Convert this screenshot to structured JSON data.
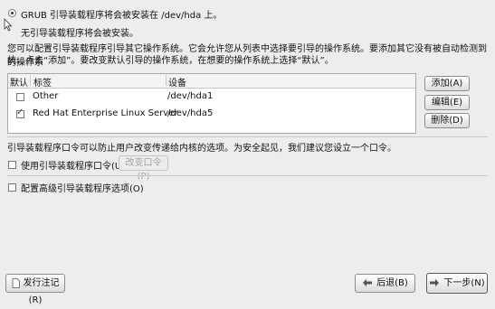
{
  "boot_target": {
    "grub_option": "GRUB 引导装载程序将会被安装在 /dev/hda 上。",
    "none_option": "无引导装载程序将会被安装。"
  },
  "description": {
    "line1": "您可以配置引导装载程序引导其它操作系统。它会允许您从列表中选择要引导的操作系统。要添加其它没有被自动检测到的操作系",
    "line2": "统，点击“添加”。要改变默认引导的操作系统，在想要的操作系统上选择“默认”。"
  },
  "table": {
    "headers": {
      "default": "默认",
      "label": "标签",
      "device": "设备"
    },
    "rows": [
      {
        "checked": false,
        "label": "Other",
        "device": "/dev/hda1"
      },
      {
        "checked": true,
        "label": "Red Hat Enterprise Linux Server",
        "device": "/dev/hda5"
      }
    ]
  },
  "side_buttons": {
    "add": "添加(A)",
    "edit": "编辑(E)",
    "delete": "删除(D)"
  },
  "password": {
    "description": "引导装载程序口令可以防止用户改变传递给内核的选项。为安全起见，我们建议您设立一个口令。",
    "use_label": "使用引导装载程序口令(U)",
    "change_button": "改变口令(P)"
  },
  "advanced": {
    "label": "配置高级引导装载程序选项(O)"
  },
  "footer": {
    "release_notes": "发行注记(R)",
    "back": "后退(B)",
    "next": "下一步(N)"
  },
  "icons": {
    "cursor": "mouse-pointer-icon",
    "release_notes": "document-icon",
    "back": "arrow-left-icon",
    "next": "arrow-right-icon"
  }
}
